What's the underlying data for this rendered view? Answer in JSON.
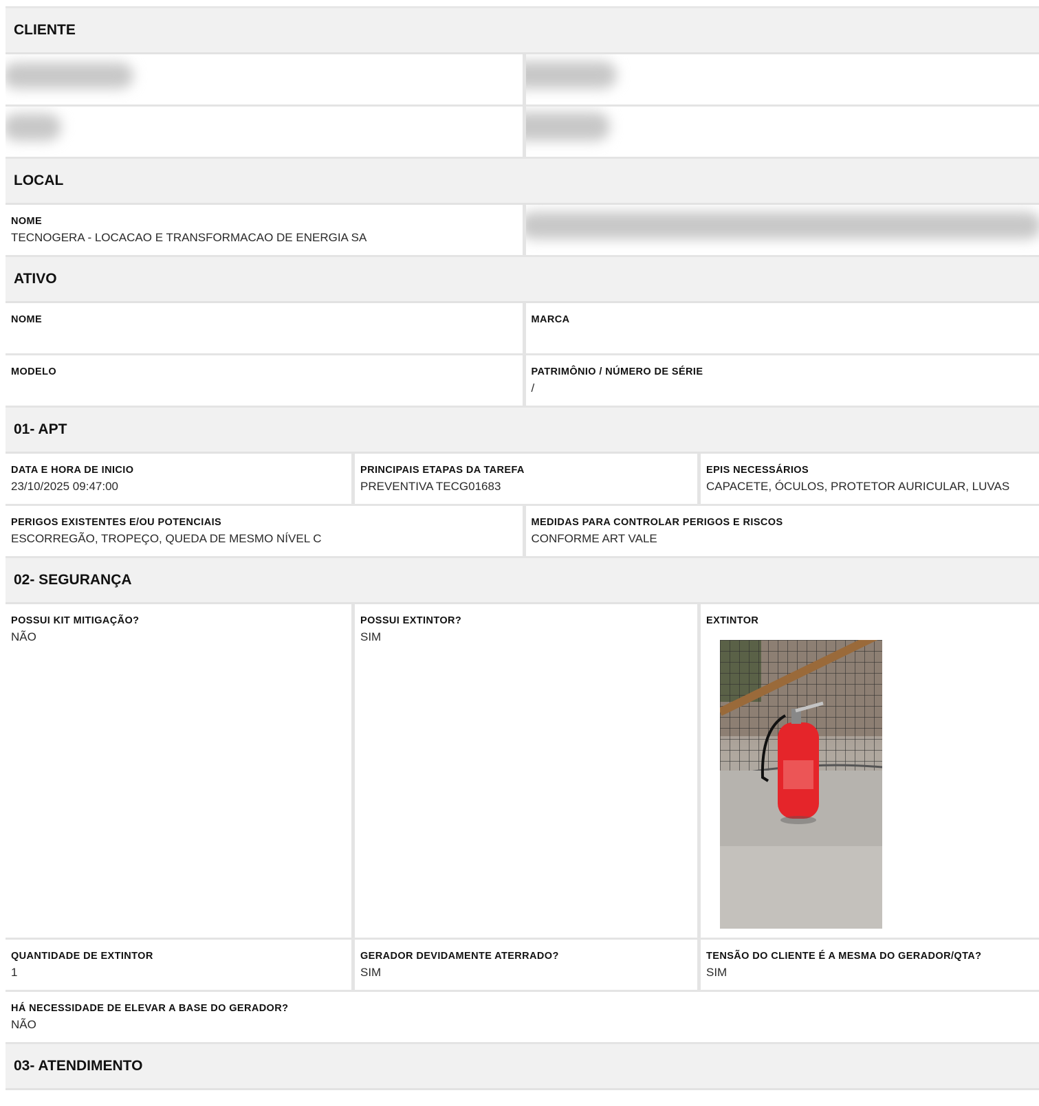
{
  "sections": {
    "cliente": "CLIENTE",
    "local": "LOCAL",
    "ativo": "ATIVO",
    "apt": "01- APT",
    "seguranca": "02- SEGURANÇA",
    "atendimento": "03- ATENDIMENTO"
  },
  "local": {
    "nome_label": "NOME",
    "nome_value": "TECNOGERA - LOCACAO E TRANSFORMACAO DE ENERGIA SA"
  },
  "ativo": {
    "nome_label": "NOME",
    "nome_value": "",
    "marca_label": "MARCA",
    "marca_value": "",
    "modelo_label": "MODELO",
    "modelo_value": "",
    "patrimonio_label": "PATRIMÔNIO / NÚMERO DE SÉRIE",
    "patrimonio_value": "/"
  },
  "apt": {
    "inicio_label": "DATA E HORA DE INICIO",
    "inicio_value": "23/10/2025 09:47:00",
    "etapas_label": "PRINCIPAIS ETAPAS DA TAREFA",
    "etapas_value": "PREVENTIVA TECG01683",
    "epis_label": "EPIS NECESSÁRIOS",
    "epis_value": "CAPACETE, ÓCULOS, PROTETOR AURICULAR, LUVAS",
    "perigos_label": "PERIGOS EXISTENTES E/OU POTENCIAIS",
    "perigos_value": "ESCORREGÃO, TROPEÇO, QUEDA DE MESMO NÍVEL C",
    "medidas_label": "MEDIDAS PARA CONTROLAR PERIGOS E RISCOS",
    "medidas_value": "CONFORME ART VALE"
  },
  "seguranca": {
    "kit_label": "POSSUI KIT MITIGAÇÃO?",
    "kit_value": "NÃO",
    "possui_extintor_label": "POSSUI EXTINTOR?",
    "possui_extintor_value": "SIM",
    "extintor_label": "EXTINTOR",
    "quantidade_label": "QUANTIDADE DE EXTINTOR",
    "quantidade_value": "1",
    "aterrado_label": "GERADOR DEVIDAMENTE ATERRADO?",
    "aterrado_value": "SIM",
    "tensao_label": "TENSÃO DO CLIENTE É A MESMA DO GERADOR/QTA?",
    "tensao_value": "SIM",
    "elevar_label": "HÁ NECESSIDADE DE ELEVAR A BASE DO GERADOR?",
    "elevar_value": "NÃO"
  }
}
